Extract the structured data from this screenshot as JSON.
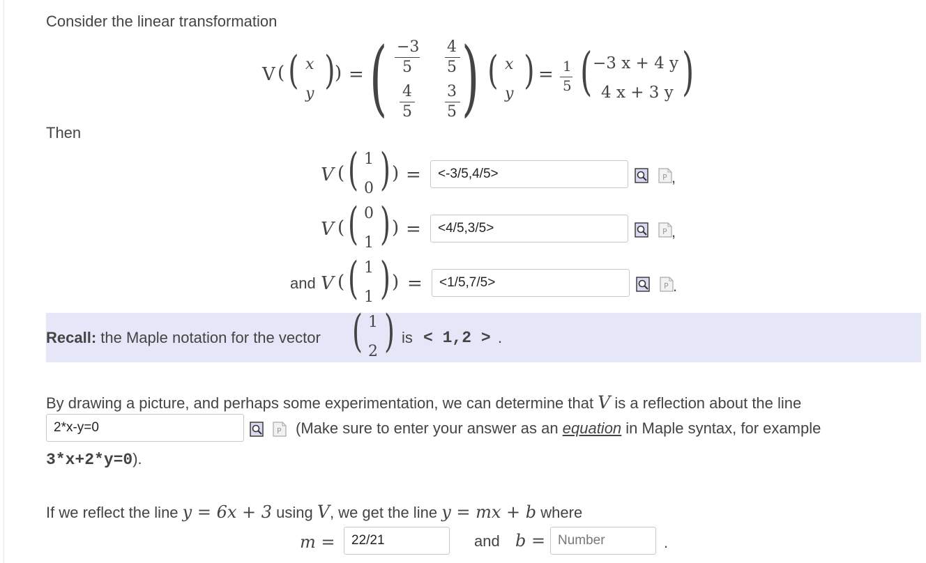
{
  "intro": "Consider the linear transformation",
  "then_label": "Then",
  "and_label": "and",
  "V": "V",
  "eq": "=",
  "eq_small": "=",
  "comma": ",",
  "period": ".",
  "matrix": {
    "a11": {
      "num": "−3",
      "den": "5"
    },
    "a12": {
      "num": "4",
      "den": "5"
    },
    "a21": {
      "num": "4",
      "den": "5"
    },
    "a22": {
      "num": "3",
      "den": "5"
    },
    "scalar": {
      "num": "1",
      "den": "5"
    },
    "row1": "−3 x + 4 y",
    "row2": "4 x + 3 y",
    "var_x": "x",
    "var_y": "y"
  },
  "vectors": [
    {
      "top": "1",
      "bottom": "0",
      "answer": "<-3/5,4/5>"
    },
    {
      "top": "0",
      "bottom": "1",
      "answer": "<4/5,3/5>"
    },
    {
      "top": "1",
      "bottom": "1",
      "answer": "<1/5,7/5>"
    }
  ],
  "recall": {
    "label": "Recall:",
    "text": "the Maple notation for the vector",
    "vec_top": "1",
    "vec_bottom": "2",
    "is": "is",
    "notation": "< 1,2 >",
    "period": "."
  },
  "reflection": {
    "text1": "By drawing a picture, and perhaps some experimentation, we can determine that",
    "V": "V",
    "text2": "is a reflection about the line",
    "answer": "2*x-y=0",
    "make_sure_pre": "(Make sure to enter your answer as an",
    "equation_link": "equation",
    "make_sure_post": "in Maple syntax, for example",
    "example_code": "3*x+2*y=0",
    "example_close": ")."
  },
  "reflect_line": {
    "t1": "If we reflect the line",
    "eq1": "y = 6x + 3",
    "t2": "using",
    "V": "V",
    "t3": ", we get the line",
    "eq2": "y = mx + b",
    "t4": "where",
    "m_label": "m =",
    "m_value": "22/21",
    "and": "and",
    "b_label": "b =",
    "b_placeholder": "Number",
    "period": "."
  },
  "icons": {
    "preview": "magnifier-preview-icon",
    "syntax": "p-syntax-icon"
  }
}
